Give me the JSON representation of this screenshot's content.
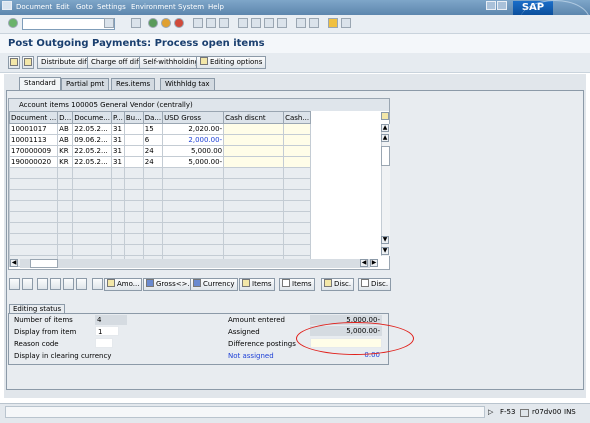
{
  "menu": [
    "Document",
    "Edit",
    "Goto",
    "Settings",
    "Environment",
    "System",
    "Help"
  ],
  "brand": "SAP",
  "title": "Post Outgoing Payments: Process open items",
  "app_toolbar": {
    "distribute": "Distribute diff.",
    "charge_off": "Charge off diff.",
    "self_withholding": "Self-withholding",
    "editing_options": "Editing options"
  },
  "tabs": [
    "Standard",
    "Partial pmt",
    "Res.items",
    "Withhldg tax"
  ],
  "table": {
    "title": "Account items 100005 General Vendor (centrally)",
    "headers": [
      "Document ...",
      "D...",
      "Docume...",
      "P...",
      "Bu...",
      "Da...",
      "USD Gross",
      "Cash discnt",
      "Cash..."
    ],
    "rows": [
      [
        "10001017",
        "AB",
        "22.05.2...",
        "31",
        "",
        "15",
        "2,020.00-",
        "",
        ""
      ],
      [
        "10001113",
        "AB",
        "09.06.2...",
        "31",
        "",
        "6",
        "2,000.00-",
        "",
        ""
      ],
      [
        "170000009",
        "KR",
        "22.05.2...",
        "31",
        "",
        "24",
        "5,000.00",
        "",
        ""
      ],
      [
        "190000020",
        "KR",
        "22.05.2...",
        "31",
        "",
        "24",
        "5,000.00-",
        "",
        ""
      ]
    ]
  },
  "buttons": {
    "amo": "Amo...",
    "gross": "Gross<>..",
    "currency": "Currency",
    "items1": "Items",
    "items2": "Items",
    "disc1": "Disc.",
    "disc2": "Disc."
  },
  "editing_status": {
    "tab": "Editing status",
    "number_of_items_label": "Number of items",
    "number_of_items": "4",
    "display_from_item_label": "Display from item",
    "display_from_item": "1",
    "reason_code_label": "Reason code",
    "display_currency_label": "Display in clearing currency",
    "amount_entered_label": "Amount entered",
    "amount_entered": "5,000.00-",
    "assigned_label": "Assigned",
    "assigned": "5,000.00-",
    "difference_label": "Difference postings",
    "difference": "",
    "not_assigned_label": "Not assigned",
    "not_assigned": "0.00"
  },
  "statusbar": {
    "tcode": "F-53",
    "server": "r07dv00",
    "mode": "INS"
  },
  "colors": {
    "accent": "#1a3f6f",
    "link_blue": "#1c3fd6",
    "annotation_red": "#e0201b"
  }
}
